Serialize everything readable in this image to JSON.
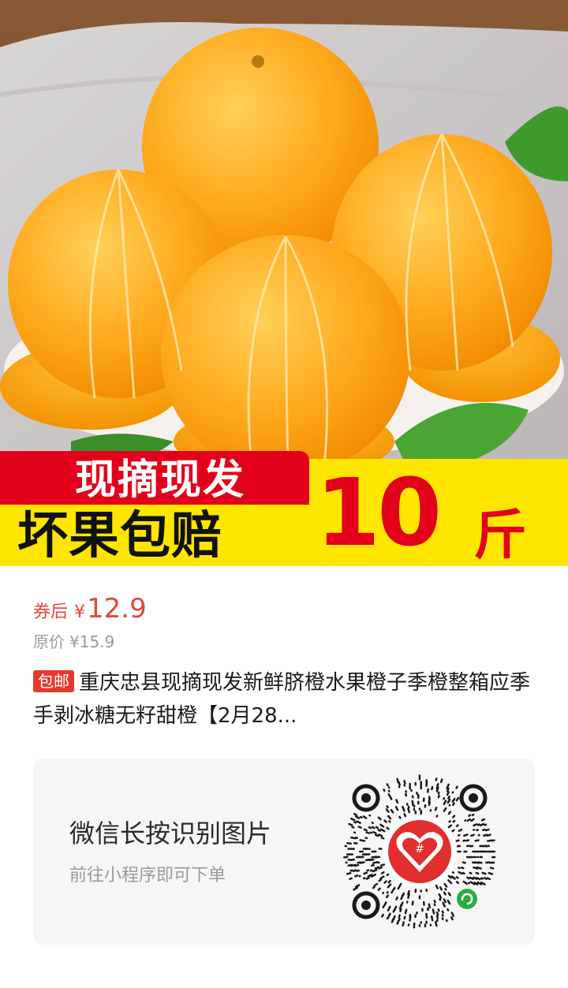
{
  "banner": {
    "line1": "现摘现发",
    "line2": "坏果包赔",
    "weight_number": "10",
    "weight_unit": "斤"
  },
  "price": {
    "label": "券后",
    "currency": "¥",
    "value": "12.9"
  },
  "original_price": {
    "label": "原价",
    "value": "¥15.9"
  },
  "product": {
    "badge": "包邮",
    "title": "重庆忠县现摘现发新鲜脐橙水果橙子季橙整箱应季手剥冰糖无籽甜橙【2月28..."
  },
  "qr_card": {
    "title": "微信长按识别图片",
    "subtitle": "前往小程序即可下单",
    "center_icon": "pinduoduo-logo-icon",
    "corner_icon": "mini-program-icon"
  },
  "colors": {
    "accent_red": "#e3001b",
    "price_red": "#e8433a",
    "banner_yellow": "#ffe600"
  }
}
